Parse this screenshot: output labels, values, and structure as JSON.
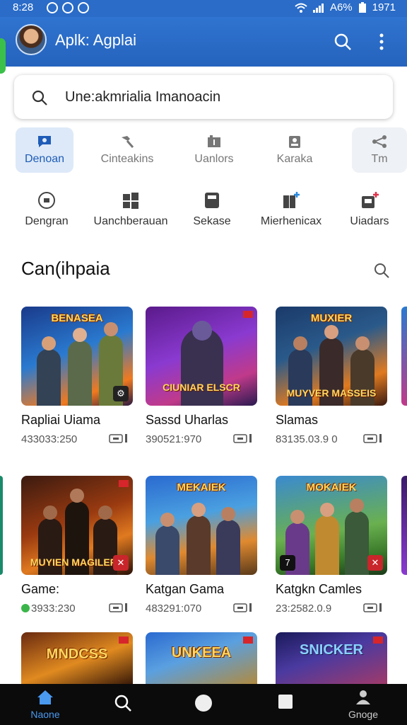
{
  "status_bar": {
    "time": "8:28",
    "battery": "A6%",
    "right_time": "1971"
  },
  "app_bar": {
    "title": "Aplk: Agplai"
  },
  "search": {
    "value": "Une:akmrialia Imanoacin"
  },
  "categories": [
    {
      "label": "Denoan",
      "icon": "chat-bubble-icon",
      "active": true
    },
    {
      "label": "Cinteakins",
      "icon": "hammer-icon",
      "active": false
    },
    {
      "label": "Uanlors",
      "icon": "folder-icon",
      "active": false
    },
    {
      "label": "Karaka",
      "icon": "badge-icon",
      "active": false
    },
    {
      "label": "Tm",
      "icon": "share-icon",
      "active": false
    }
  ],
  "subcategories": [
    {
      "label": "Dengran",
      "icon": "chat-icon"
    },
    {
      "label": "Uanchberauan",
      "icon": "windows-icon"
    },
    {
      "label": "Sekase",
      "icon": "box-icon"
    },
    {
      "label": "Mierhenicax",
      "icon": "book-plus-icon"
    },
    {
      "label": "Uiadars",
      "icon": "bag-plus-icon"
    }
  ],
  "section": {
    "title": "Can(ihpaia"
  },
  "games": [
    {
      "name": "Rapliai Uiama",
      "meta": "433033:250",
      "banner": "BENASEA",
      "banner2": ""
    },
    {
      "name": "Sassd Uharlas",
      "meta": "390521:970",
      "banner": "",
      "banner2": "CIUNIAR ELSCR"
    },
    {
      "name": "Slamas",
      "meta": "83135.03.9 0",
      "banner": "MUXIER",
      "banner2": "MUYVER MASSEIS"
    },
    {
      "name": "Game:",
      "meta": "3933:230",
      "banner": "",
      "banner2": "MUYIEN MAGILERS"
    },
    {
      "name": "Katgan Gama",
      "meta": "483291:070",
      "banner": "MEKAIEK",
      "banner2": ""
    },
    {
      "name": "Katgkn Camles",
      "meta": "23:2582.0.9",
      "banner": "MOKAIEK",
      "banner2": ""
    },
    {
      "name": "",
      "meta": "",
      "banner": "MNDCSS",
      "banner2": ""
    },
    {
      "name": "",
      "meta": "",
      "banner": "UNKEEA",
      "banner2": ""
    },
    {
      "name": "",
      "meta": "",
      "banner": "SNICKER",
      "banner2": ""
    }
  ],
  "bottom_nav": [
    {
      "label": "Naone",
      "icon": "home-icon"
    },
    {
      "label": "",
      "icon": "search-icon"
    },
    {
      "label": "",
      "icon": "circle-icon"
    },
    {
      "label": "",
      "icon": "square-icon"
    },
    {
      "label": "Gnoge",
      "icon": "profile-icon"
    }
  ],
  "colors": {
    "primary": "#2a6cc8",
    "active_tab_bg": "#dde9f8",
    "nav_bg": "#0b0b0b",
    "accent_green": "#3bb54a"
  }
}
